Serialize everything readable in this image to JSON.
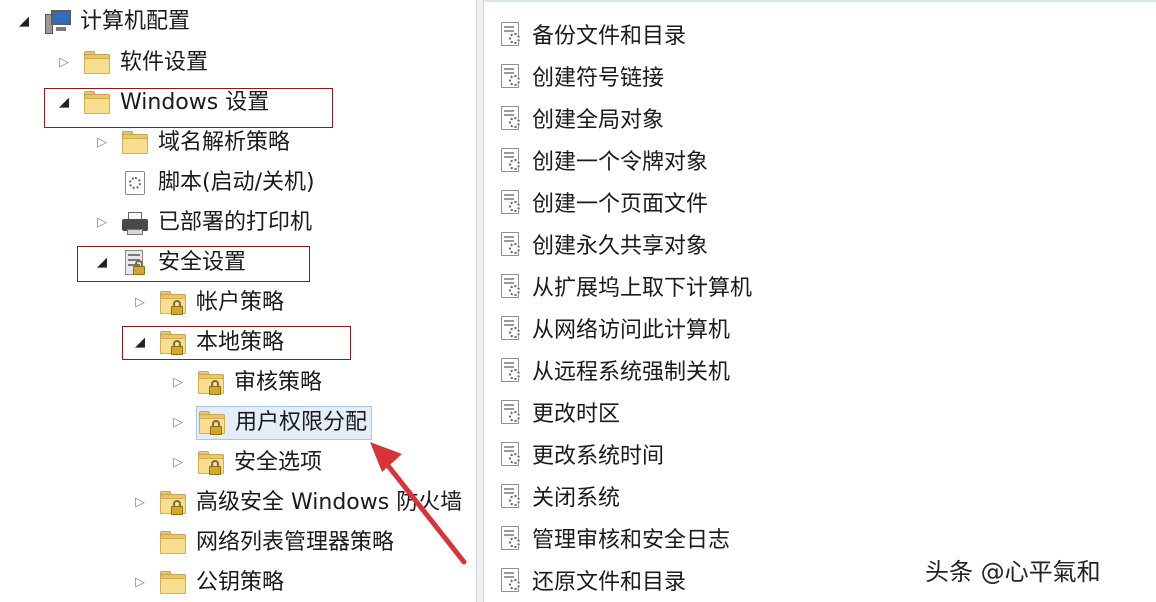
{
  "tree": {
    "nodes": [
      {
        "label": "计算机配置",
        "icon": "computer-icon",
        "state": "expanded"
      },
      {
        "label": "软件设置",
        "icon": "folder-icon",
        "state": "collapsed"
      },
      {
        "label": "Windows 设置",
        "icon": "folder-icon",
        "state": "expanded"
      },
      {
        "label": "域名解析策略",
        "icon": "folder-icon",
        "state": "collapsed"
      },
      {
        "label": "脚本(启动/关机)",
        "icon": "script-icon",
        "state": "none"
      },
      {
        "label": "已部署的打印机",
        "icon": "printer-icon",
        "state": "collapsed"
      },
      {
        "label": "安全设置",
        "icon": "security-icon",
        "state": "expanded"
      },
      {
        "label": "帐户策略",
        "icon": "locked-folder-icon",
        "state": "collapsed"
      },
      {
        "label": "本地策略",
        "icon": "locked-folder-icon",
        "state": "expanded"
      },
      {
        "label": "审核策略",
        "icon": "locked-folder-icon",
        "state": "collapsed"
      },
      {
        "label": "用户权限分配",
        "icon": "locked-folder-icon",
        "state": "collapsed",
        "selected": true
      },
      {
        "label": "安全选项",
        "icon": "locked-folder-icon",
        "state": "collapsed"
      },
      {
        "label": "高级安全 Windows 防火墙",
        "icon": "locked-folder-icon",
        "state": "collapsed"
      },
      {
        "label": "网络列表管理器策略",
        "icon": "folder-icon",
        "state": "none"
      },
      {
        "label": "公钥策略",
        "icon": "folder-icon",
        "state": "collapsed"
      }
    ]
  },
  "policies": [
    "备份文件和目录",
    "创建符号链接",
    "创建全局对象",
    "创建一个令牌对象",
    "创建一个页面文件",
    "创建永久共享对象",
    "从扩展坞上取下计算机",
    "从网络访问此计算机",
    "从远程系统强制关机",
    "更改时区",
    "更改系统时间",
    "关闭系统",
    "管理审核和安全日志",
    "还原文件和目录"
  ],
  "watermark": "头条 @心平氣和",
  "colors": {
    "highlight_border": "#8b1a1a",
    "callout_arrow": "#d9333a",
    "selection_background": "#e4eef8"
  }
}
